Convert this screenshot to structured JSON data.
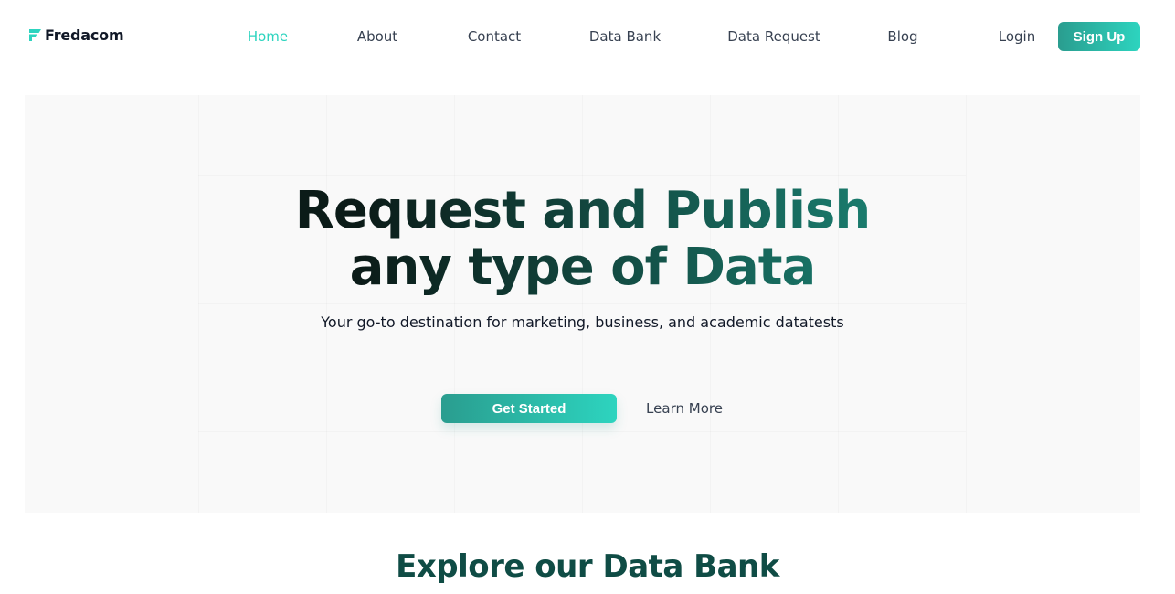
{
  "brand": {
    "name": "Fredacom",
    "logo_icon": "bookmark-flag-icon",
    "accent_color": "#2dd4bf",
    "accent_dark": "#2a9d8f",
    "heading_color": "#0f4c45"
  },
  "nav": {
    "items": [
      {
        "label": "Home",
        "active": true
      },
      {
        "label": "About",
        "active": false
      },
      {
        "label": "Contact",
        "active": false
      },
      {
        "label": "Data Bank",
        "active": false
      },
      {
        "label": "Data Request",
        "active": false
      },
      {
        "label": "Blog",
        "active": false
      }
    ],
    "login_label": "Login",
    "signup_label": "Sign Up"
  },
  "hero": {
    "title_line1": "Request and Publish",
    "title_line2": "any type of Data",
    "subtitle": "Your go-to destination for marketing, business, and academic datatests",
    "primary_cta": "Get Started",
    "secondary_cta": "Learn More"
  },
  "sections": {
    "databank_title": "Explore our Data Bank"
  }
}
